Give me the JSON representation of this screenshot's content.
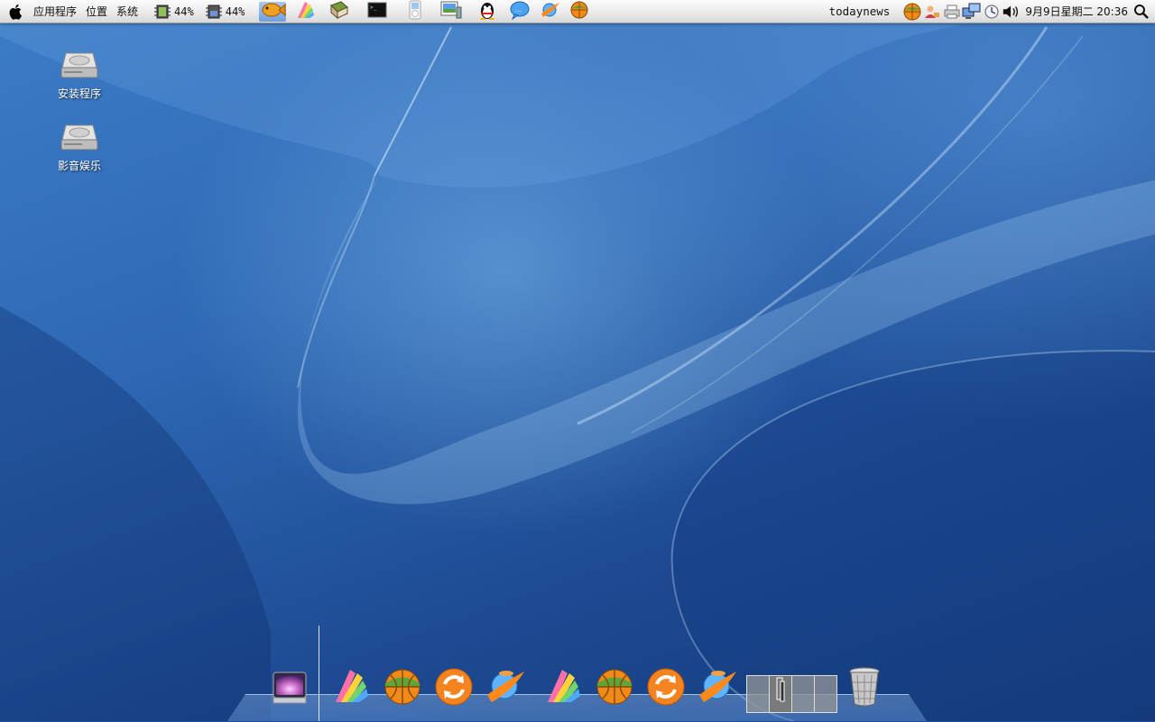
{
  "top_panel": {
    "menus": [
      "应用程序",
      "位置",
      "系统"
    ],
    "cpu_meter": "44%",
    "memory_meter": "44%",
    "launchers": [
      {
        "name": "fish-icon",
        "active": true
      },
      {
        "name": "colorful-pages-icon"
      },
      {
        "name": "book-icon"
      },
      {
        "name": "terminal-icon"
      },
      {
        "name": "ipod-icon"
      },
      {
        "name": "image-viewer-icon"
      },
      {
        "name": "qq-penguin-icon"
      },
      {
        "name": "chat-bubble-icon"
      },
      {
        "name": "wine-icon"
      },
      {
        "name": "basketball-icon"
      }
    ],
    "tray_text": "todaynews",
    "clock": "9月9日星期二 20:36"
  },
  "desktop_icons": [
    {
      "label": "安装程序"
    },
    {
      "label": "影音娱乐"
    }
  ],
  "dock": {
    "items": [
      "launchpad-icon",
      "colorful-pages-icon",
      "basketball-icon",
      "refresh-icon",
      "wine-icon",
      "colorful-pages-icon",
      "basketball-icon",
      "refresh-icon",
      "wine-icon"
    ],
    "workspaces": 4,
    "active_workspace": 2,
    "trash": "trash-icon"
  },
  "colors": {
    "panel_bg": "#e9e9e9",
    "wallpaper_blue": "#2f69b6",
    "desktop_text": "#ffffff"
  }
}
